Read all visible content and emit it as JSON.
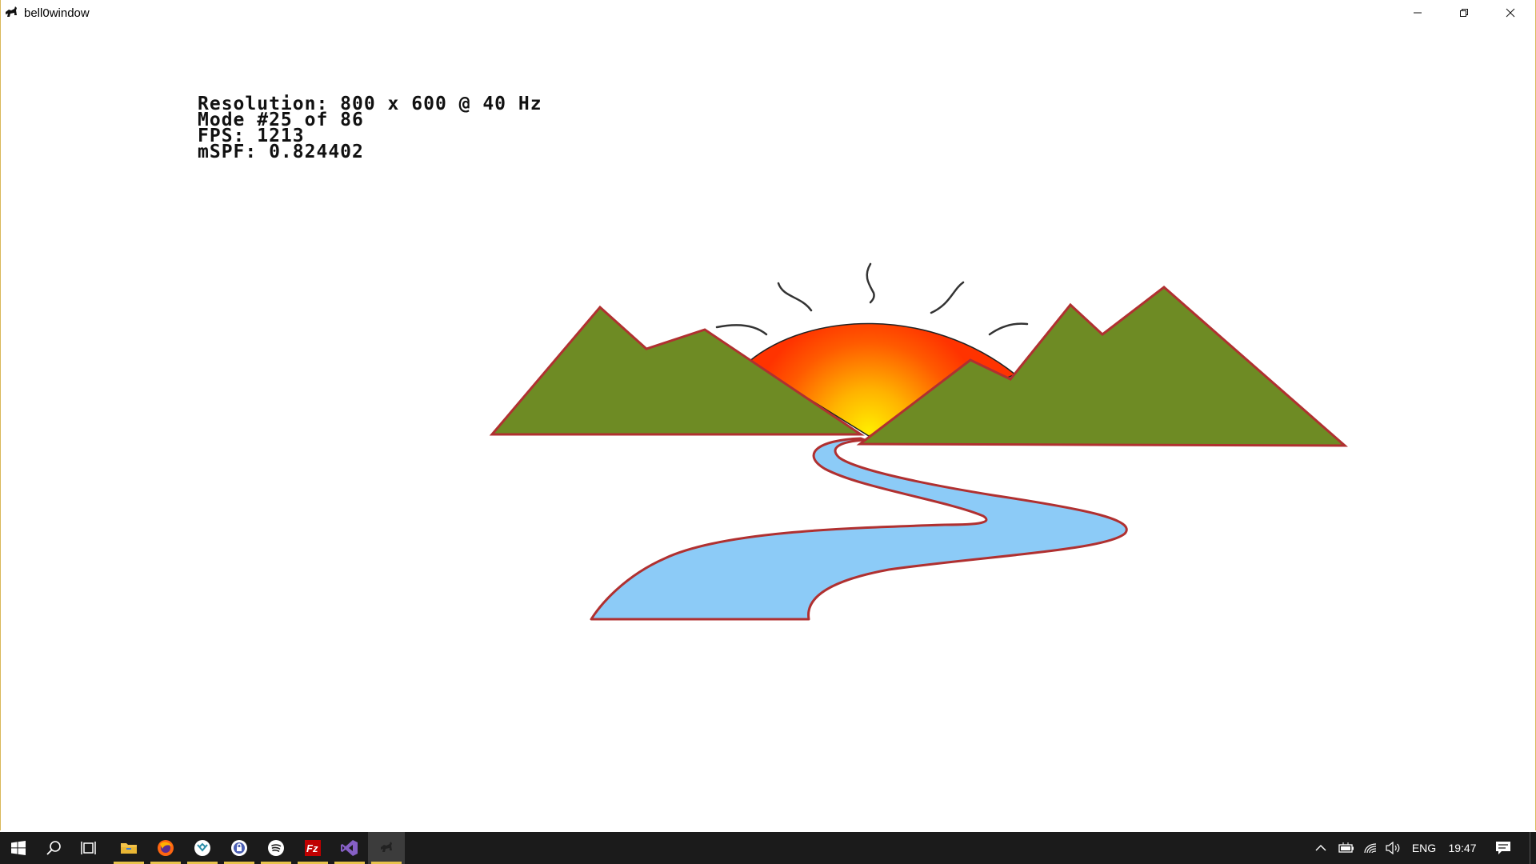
{
  "window": {
    "title": "bell0window",
    "controls": {
      "minimize": "minimize-icon",
      "restore": "restore-icon",
      "close": "close-icon"
    }
  },
  "overlay": {
    "resolution": "Resolution: 800 x 600 @ 40 Hz",
    "mode": "Mode #25 of 86",
    "fps": "FPS: 1213",
    "mspf": "mSPF: 0.824402"
  },
  "scene": {
    "colors": {
      "mountain": "#6e8b24",
      "outline": "#b03030",
      "river": "#8ccbf7",
      "sun_inner": "#ffee00",
      "sun_outer": "#ff3300",
      "rays": "#333333"
    }
  },
  "taskbar": {
    "apps": [
      {
        "name": "start-icon"
      },
      {
        "name": "search-icon"
      },
      {
        "name": "task-view-icon"
      },
      {
        "name": "file-explorer-icon"
      },
      {
        "name": "firefox-icon"
      },
      {
        "name": "vscode-icon"
      },
      {
        "name": "keepass-icon"
      },
      {
        "name": "spotify-icon"
      },
      {
        "name": "filezilla-icon"
      },
      {
        "name": "visual-studio-icon"
      },
      {
        "name": "bell0window-app-icon"
      }
    ],
    "tray": {
      "language": "ENG",
      "time": "19:47"
    }
  }
}
